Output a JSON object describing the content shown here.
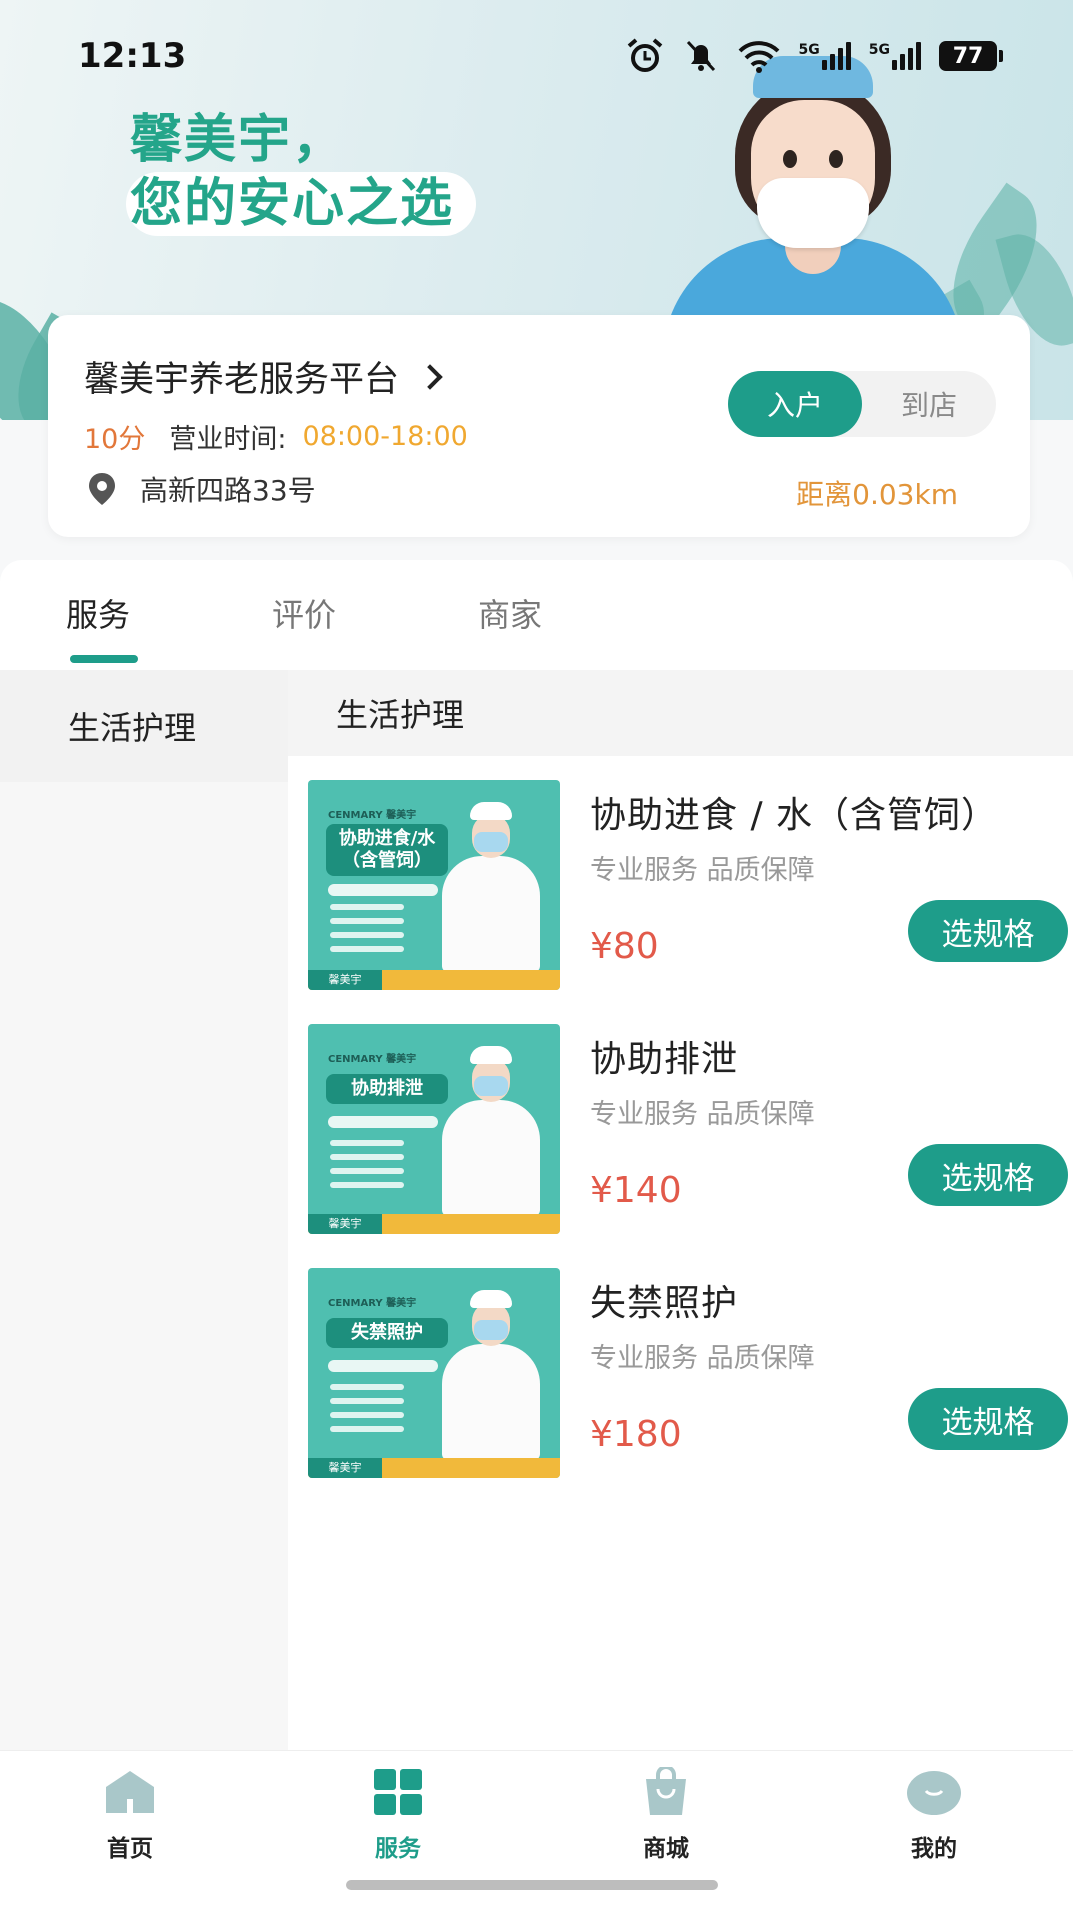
{
  "status_bar": {
    "time": "12:13",
    "signal1": "5G",
    "signal2": "5G",
    "battery": "77"
  },
  "banner": {
    "slogan_line1": "馨美宇，",
    "slogan_line2": "您的安心之选"
  },
  "store": {
    "name": "馨美宇养老服务平台",
    "score": "10分",
    "hours_label": "营业时间:",
    "hours": "08:00-18:00",
    "address": "高新四路33号",
    "mode_options": [
      "入户",
      "到店"
    ],
    "mode_selected": "入户",
    "distance": "距离0.03km"
  },
  "tabs": [
    {
      "label": "服务",
      "active": true
    },
    {
      "label": "评价",
      "active": false
    },
    {
      "label": "商家",
      "active": false
    }
  ],
  "sidebar": {
    "items": [
      {
        "label": "生活护理",
        "active": true
      }
    ]
  },
  "section": {
    "title": "生活护理"
  },
  "products": [
    {
      "title": "协助进食 / 水（含管饲）",
      "subtitle": "专业服务 品质保障",
      "price": "¥80",
      "button": "选规格",
      "thumb_brand": "CENMARY 馨美宇",
      "thumb_title": "协助进食/水（含管饲）",
      "thumb_logo": "馨美宇"
    },
    {
      "title": "协助排泄",
      "subtitle": "专业服务 品质保障",
      "price": "¥140",
      "button": "选规格",
      "thumb_brand": "CENMARY 馨美宇",
      "thumb_title": "协助排泄",
      "thumb_logo": "馨美宇"
    },
    {
      "title": "失禁照护",
      "subtitle": "专业服务 品质保障",
      "price": "¥180",
      "button": "选规格",
      "thumb_brand": "CENMARY 馨美宇",
      "thumb_title": "失禁照护",
      "thumb_logo": "馨美宇"
    }
  ],
  "bottom_nav": [
    {
      "label": "首页",
      "icon": "home-icon",
      "active": false
    },
    {
      "label": "服务",
      "icon": "grid-icon",
      "active": true
    },
    {
      "label": "商城",
      "icon": "shopping-bag-icon",
      "active": false
    },
    {
      "label": "我的",
      "icon": "profile-icon",
      "active": false
    }
  ],
  "colors": {
    "accent": "#1e9d8a",
    "price": "#e25a4a",
    "score": "#e2773a",
    "hours": "#f0a830",
    "distance": "#e2953a"
  }
}
